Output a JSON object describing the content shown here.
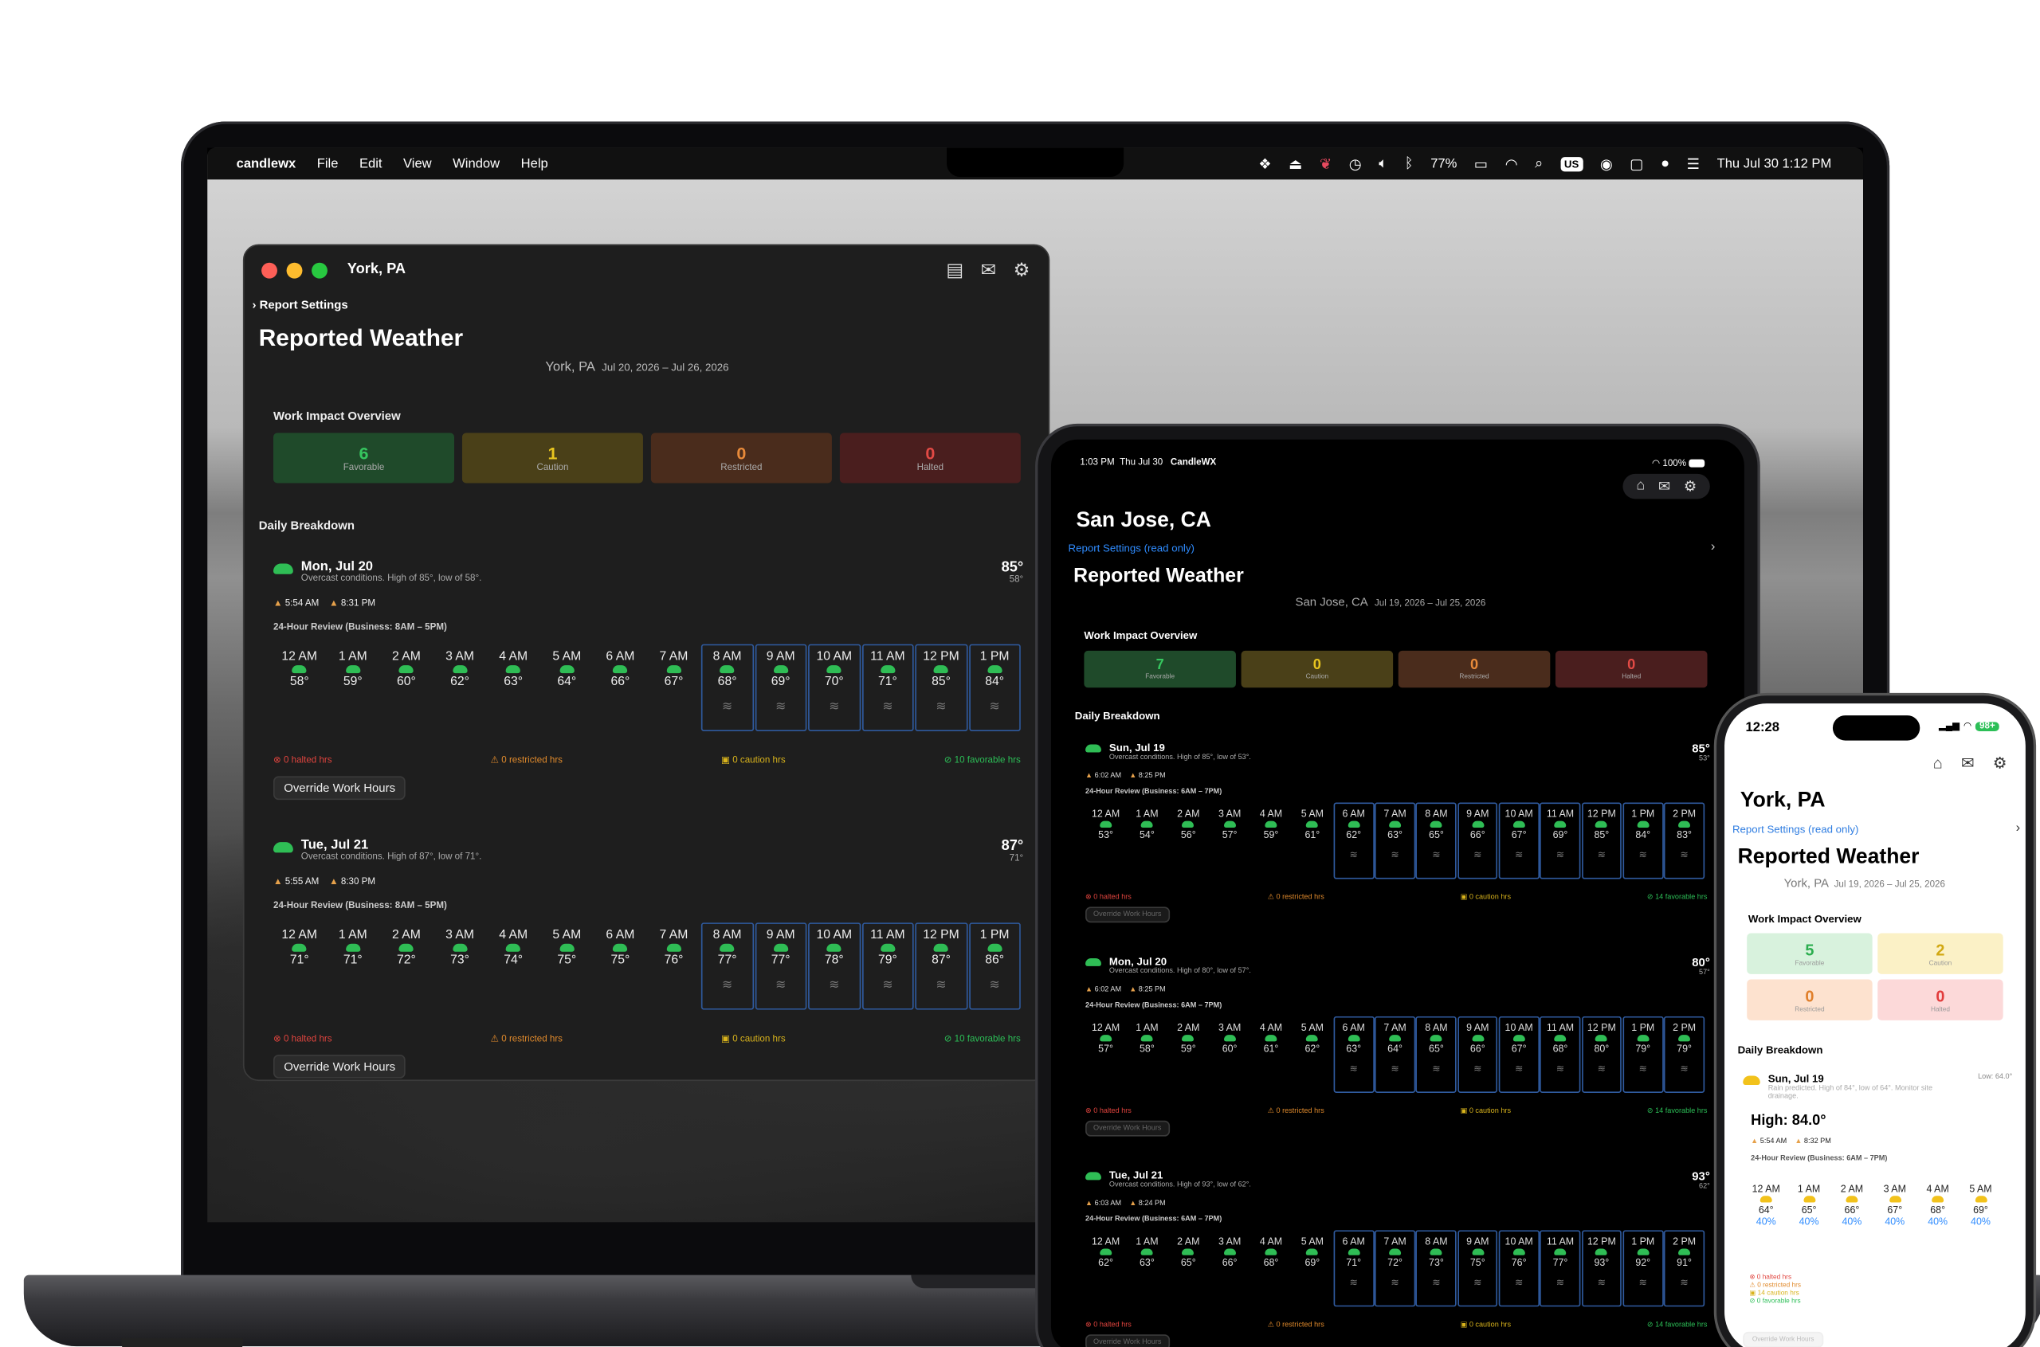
{
  "mac": {
    "menubar": {
      "app": "candlewx",
      "menus": [
        "File",
        "Edit",
        "View",
        "Window",
        "Help"
      ],
      "battery": "77%",
      "locale": "US",
      "clock": "Thu Jul 30  1:12 PM"
    },
    "window": {
      "title": "York, PA",
      "report_settings": "Report Settings",
      "heading": "Reported Weather",
      "location": "York, PA",
      "range": "Jul 20, 2026 – Jul 26, 2026",
      "overview_title": "Work Impact Overview",
      "tiles": [
        {
          "n": "6",
          "label": "Favorable"
        },
        {
          "n": "1",
          "label": "Caution"
        },
        {
          "n": "0",
          "label": "Restricted"
        },
        {
          "n": "0",
          "label": "Halted"
        }
      ],
      "breakdown_title": "Daily Breakdown",
      "override": "Override Work Hours",
      "days": [
        {
          "title": "Mon, Jul 20",
          "summary": "Overcast conditions. High of 85°, low of 58°.",
          "high": "85°",
          "low": "58°",
          "sunrise": "5:54 AM",
          "sunset": "8:31 PM",
          "review": "24-Hour Review (Business: 8AM – 5PM)",
          "hours": [
            [
              "12 AM",
              "58°"
            ],
            [
              "1 AM",
              "59°"
            ],
            [
              "2 AM",
              "60°"
            ],
            [
              "3 AM",
              "62°"
            ],
            [
              "4 AM",
              "63°"
            ],
            [
              "5 AM",
              "64°"
            ],
            [
              "6 AM",
              "66°"
            ],
            [
              "7 AM",
              "67°"
            ],
            [
              "8 AM",
              "68°"
            ],
            [
              "9 AM",
              "69°"
            ],
            [
              "10 AM",
              "70°"
            ],
            [
              "11 AM",
              "71°"
            ],
            [
              "12 PM",
              "85°"
            ],
            [
              "1 PM",
              "84°"
            ]
          ],
          "halted": "0 halted hrs",
          "restricted": "0 restricted hrs",
          "caution": "0 caution hrs",
          "favorable": "10 favorable hrs"
        },
        {
          "title": "Tue, Jul 21",
          "summary": "Overcast conditions. High of 87°, low of 71°.",
          "high": "87°",
          "low": "71°",
          "sunrise": "5:55 AM",
          "sunset": "8:30 PM",
          "review": "24-Hour Review (Business: 8AM – 5PM)",
          "hours": [
            [
              "12 AM",
              "71°"
            ],
            [
              "1 AM",
              "71°"
            ],
            [
              "2 AM",
              "72°"
            ],
            [
              "3 AM",
              "73°"
            ],
            [
              "4 AM",
              "74°"
            ],
            [
              "5 AM",
              "75°"
            ],
            [
              "6 AM",
              "75°"
            ],
            [
              "7 AM",
              "76°"
            ],
            [
              "8 AM",
              "77°"
            ],
            [
              "9 AM",
              "77°"
            ],
            [
              "10 AM",
              "78°"
            ],
            [
              "11 AM",
              "79°"
            ],
            [
              "12 PM",
              "87°"
            ],
            [
              "1 PM",
              "86°"
            ]
          ],
          "halted": "0 halted hrs",
          "restricted": "0 restricted hrs",
          "caution": "0 caution hrs",
          "favorable": "10 favorable hrs"
        }
      ]
    }
  },
  "ipad": {
    "status": {
      "time": "1:03 PM",
      "date": "Thu Jul 30",
      "app": "CandleWX",
      "battery": "100%"
    },
    "location_title": "San Jose, CA",
    "report_settings": "Report Settings (read only)",
    "heading": "Reported Weather",
    "location": "San Jose, CA",
    "range": "Jul 19, 2026 – Jul 25, 2026",
    "overview_title": "Work Impact Overview",
    "tiles": [
      {
        "n": "7",
        "label": "Favorable"
      },
      {
        "n": "0",
        "label": "Caution"
      },
      {
        "n": "0",
        "label": "Restricted"
      },
      {
        "n": "0",
        "label": "Halted"
      }
    ],
    "breakdown_title": "Daily Breakdown",
    "override": "Override Work Hours",
    "days": [
      {
        "title": "Sun, Jul 19",
        "summary": "Overcast conditions. High of 85°, low of 53°.",
        "high": "85°",
        "low": "53°",
        "sunrise": "6:02 AM",
        "sunset": "8:25 PM",
        "review": "24-Hour Review (Business: 6AM – 7PM)",
        "hours": [
          [
            "12 AM",
            "53°"
          ],
          [
            "1 AM",
            "54°"
          ],
          [
            "2 AM",
            "56°"
          ],
          [
            "3 AM",
            "57°"
          ],
          [
            "4 AM",
            "59°"
          ],
          [
            "5 AM",
            "61°"
          ],
          [
            "6 AM",
            "62°"
          ],
          [
            "7 AM",
            "63°"
          ],
          [
            "8 AM",
            "65°"
          ],
          [
            "9 AM",
            "66°"
          ],
          [
            "10 AM",
            "67°"
          ],
          [
            "11 AM",
            "69°"
          ],
          [
            "12 PM",
            "85°"
          ],
          [
            "1 PM",
            "84°"
          ],
          [
            "2 PM",
            "83°"
          ]
        ],
        "halted": "0 halted hrs",
        "restricted": "0 restricted hrs",
        "caution": "0 caution hrs",
        "favorable": "14 favorable hrs"
      },
      {
        "title": "Mon, Jul 20",
        "summary": "Overcast conditions. High of 80°, low of 57°.",
        "high": "80°",
        "low": "57°",
        "sunrise": "6:02 AM",
        "sunset": "8:25 PM",
        "review": "24-Hour Review (Business: 6AM – 7PM)",
        "hours": [
          [
            "12 AM",
            "57°"
          ],
          [
            "1 AM",
            "58°"
          ],
          [
            "2 AM",
            "59°"
          ],
          [
            "3 AM",
            "60°"
          ],
          [
            "4 AM",
            "61°"
          ],
          [
            "5 AM",
            "62°"
          ],
          [
            "6 AM",
            "63°"
          ],
          [
            "7 AM",
            "64°"
          ],
          [
            "8 AM",
            "65°"
          ],
          [
            "9 AM",
            "66°"
          ],
          [
            "10 AM",
            "67°"
          ],
          [
            "11 AM",
            "68°"
          ],
          [
            "12 PM",
            "80°"
          ],
          [
            "1 PM",
            "79°"
          ],
          [
            "2 PM",
            "79°"
          ]
        ],
        "halted": "0 halted hrs",
        "restricted": "0 restricted hrs",
        "caution": "0 caution hrs",
        "favorable": "14 favorable hrs"
      },
      {
        "title": "Tue, Jul 21",
        "summary": "Overcast conditions. High of 93°, low of 62°.",
        "high": "93°",
        "low": "62°",
        "sunrise": "6:03 AM",
        "sunset": "8:24 PM",
        "review": "24-Hour Review (Business: 6AM – 7PM)",
        "hours": [
          [
            "12 AM",
            "62°"
          ],
          [
            "1 AM",
            "63°"
          ],
          [
            "2 AM",
            "65°"
          ],
          [
            "3 AM",
            "66°"
          ],
          [
            "4 AM",
            "68°"
          ],
          [
            "5 AM",
            "69°"
          ],
          [
            "6 AM",
            "71°"
          ],
          [
            "7 AM",
            "72°"
          ],
          [
            "8 AM",
            "73°"
          ],
          [
            "9 AM",
            "75°"
          ],
          [
            "10 AM",
            "76°"
          ],
          [
            "11 AM",
            "77°"
          ],
          [
            "12 PM",
            "93°"
          ],
          [
            "1 PM",
            "92°"
          ],
          [
            "2 PM",
            "91°"
          ]
        ],
        "halted": "0 halted hrs",
        "restricted": "0 restricted hrs",
        "caution": "0 caution hrs",
        "favorable": "14 favorable hrs"
      }
    ]
  },
  "iphone": {
    "status": {
      "time": "12:28",
      "battery": "98+"
    },
    "location_title": "York, PA",
    "report_settings": "Report Settings (read only)",
    "heading": "Reported Weather",
    "location": "York, PA",
    "range": "Jul 19, 2026 – Jul 25, 2026",
    "overview_title": "Work Impact Overview",
    "tiles": [
      {
        "n": "5",
        "label": "Favorable"
      },
      {
        "n": "2",
        "label": "Caution"
      },
      {
        "n": "0",
        "label": "Restricted"
      },
      {
        "n": "0",
        "label": "Halted"
      }
    ],
    "breakdown_title": "Daily Breakdown",
    "day": {
      "title": "Sun, Jul 19",
      "summary": "Rain predicted. High of 84°, low of 64°. Monitor site drainage.",
      "high": "High: 84.0°",
      "low": "Low: 64.0°",
      "sunrise": "5:54 AM",
      "sunset": "8:32 PM",
      "review": "24-Hour Review (Business: 6AM – 7PM)",
      "hours": [
        [
          "12 AM",
          "64°",
          "40%"
        ],
        [
          "1 AM",
          "65°",
          "40%"
        ],
        [
          "2 AM",
          "66°",
          "40%"
        ],
        [
          "3 AM",
          "67°",
          "40%"
        ],
        [
          "4 AM",
          "68°",
          "40%"
        ],
        [
          "5 AM",
          "69°",
          "40%"
        ]
      ],
      "halted": "0 halted hrs",
      "restricted": "0 restricted hrs",
      "caution": "14 caution hrs",
      "favorable": "0 favorable hrs"
    },
    "override": "Override Work Hours"
  }
}
